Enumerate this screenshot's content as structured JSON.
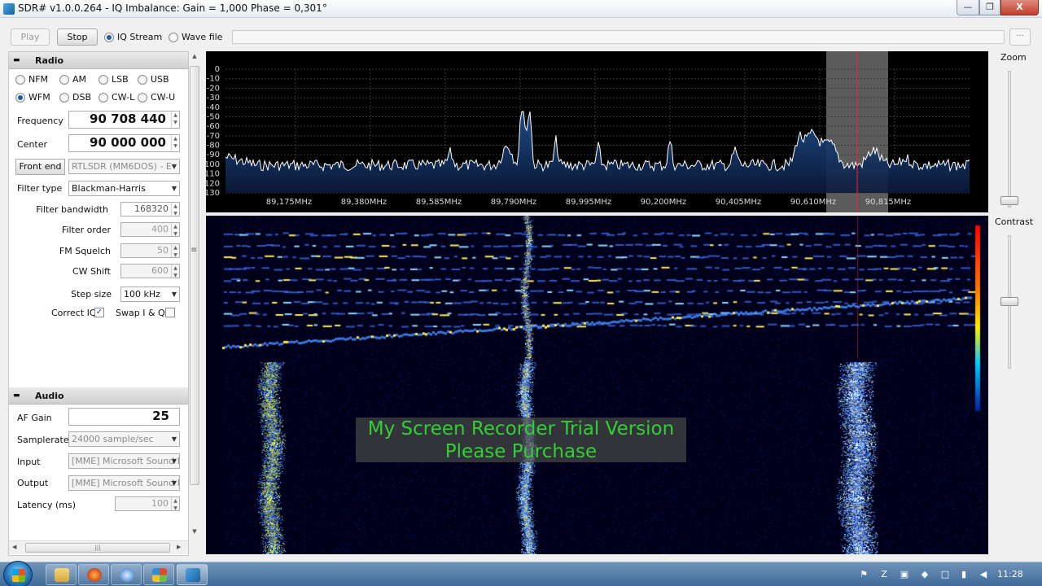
{
  "window": {
    "title": "SDR# v1.0.0.264 - IQ Imbalance: Gain = 1,000 Phase = 0,301°",
    "min_glyph": "—",
    "max_glyph": "❐",
    "close_glyph": "X"
  },
  "toolbar": {
    "play_label": "Play",
    "stop_label": "Stop",
    "iq_stream_label": "IQ Stream",
    "wave_file_label": "Wave file",
    "more_label": "..."
  },
  "radio": {
    "header": "Radio",
    "modes_row1": [
      "NFM",
      "AM",
      "LSB",
      "USB"
    ],
    "modes_row2": [
      "WFM",
      "DSB",
      "CW-L",
      "CW-U"
    ],
    "selected_mode": "WFM",
    "frequency_label": "Frequency",
    "frequency_value": "90 708 440",
    "center_label": "Center",
    "center_value": "90 000 000",
    "front_end_label": "Front end",
    "front_end_value": "RTLSDR (MM6DOS) - E",
    "filter_type_label": "Filter type",
    "filter_type_value": "Blackman-Harris",
    "filter_bandwidth_label": "Filter bandwidth",
    "filter_bandwidth_value": "168320",
    "filter_order_label": "Filter order",
    "filter_order_value": "400",
    "fm_squelch_label": "FM Squelch",
    "fm_squelch_value": "50",
    "cw_shift_label": "CW Shift",
    "cw_shift_value": "600",
    "step_size_label": "Step size",
    "step_size_value": "100 kHz",
    "correct_iq_label": "Correct IQ",
    "correct_iq_checked": true,
    "swap_iq_label": "Swap I & Q",
    "swap_iq_checked": false
  },
  "audio": {
    "header": "Audio",
    "af_gain_label": "AF Gain",
    "af_gain_value": "25",
    "samplerate_label": "Samplerate",
    "samplerate_value": "24000 sample/sec",
    "input_label": "Input",
    "input_value": "[MME] Microsoft Sound I",
    "output_label": "Output",
    "output_value": "[MME] Microsoft Sound I",
    "latency_label": "Latency (ms)",
    "latency_value": "100"
  },
  "spectrum": {
    "db_ticks": [
      "0",
      "-10",
      "-20",
      "-30",
      "-40",
      "-50",
      "-60",
      "-70",
      "-80",
      "-90",
      "-100",
      "-110",
      "-120",
      "-130"
    ],
    "freq_ticks": [
      "89,175MHz",
      "89,380MHz",
      "89,585MHz",
      "89,790MHz",
      "89,995MHz",
      "90,200MHz",
      "90,405MHz",
      "90,610MHz",
      "90,815MHz"
    ],
    "trace_color": "#ffffff",
    "fill_color": "#1f4f8f",
    "grid_color": "#3a3a3a",
    "tuned_line_color": "#ff2020"
  },
  "right_panel": {
    "zoom_label": "Zoom",
    "contrast_label": "Contrast"
  },
  "watermark": {
    "line1": "My Screen Recorder Trial Version",
    "line2": "Please Purchase",
    "color": "#31d033"
  },
  "taskbar": {
    "clock": "11:28",
    "tray_icons": [
      "flag-icon",
      "language-icon",
      "network-device-icon",
      "shield-icon",
      "window-icon",
      "signal-icon",
      "volume-icon"
    ]
  }
}
